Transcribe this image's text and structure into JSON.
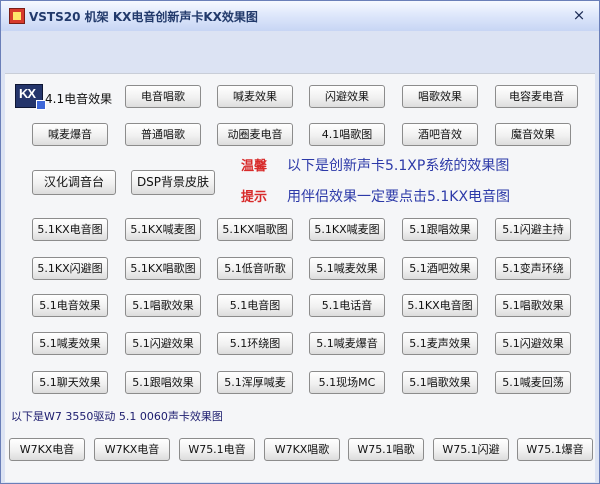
{
  "window": {
    "title": "VSTS20 机架 KX电音创新声卡KX效果图",
    "close_glyph": "×"
  },
  "logo": {
    "text": "KX"
  },
  "label_41": "4.1电音效果",
  "row1": [
    "电音唱歌",
    "喊麦效果",
    "闪避效果",
    "唱歌效果",
    "电容麦电音"
  ],
  "row2": [
    "喊麦爆音",
    "普通唱歌",
    "动圈麦电音",
    "4.1唱歌图",
    "酒吧音效",
    "魔音效果"
  ],
  "tools": [
    "汉化调音台",
    "DSP背景皮肤"
  ],
  "info": [
    {
      "label": "温馨",
      "text": "以下是创新声卡5.1XP系统的效果图"
    },
    {
      "label": "提示",
      "text": "用伴侣效果一定要点击5.1KX电音图"
    }
  ],
  "grid": [
    [
      "5.1KX电音图",
      "5.1KX喊麦图",
      "5.1KX唱歌图",
      "5.1KX喊麦图",
      "5.1跟唱效果",
      "5.1闪避主持"
    ],
    [
      "5.1KX闪避图",
      "5.1KX唱歌图",
      "5.1低音听歌",
      "5.1喊麦效果",
      "5.1酒吧效果",
      "5.1变声环绕"
    ],
    [
      "5.1电音效果",
      "5.1唱歌效果",
      "5.1电音图",
      "5.1电话音",
      "5.1KX电音图",
      "5.1唱歌效果"
    ],
    [
      "5.1喊麦效果",
      "5.1闪避效果",
      "5.1环绕图",
      "5.1喊麦爆音",
      "5.1麦声效果",
      "5.1闪避效果"
    ],
    [
      "5.1聊天效果",
      "5.1跟唱效果",
      "5.1浑厚喊麦",
      "5.1现场MC",
      "5.1唱歌效果",
      "5.1喊麦回荡"
    ]
  ],
  "section_label": "以下是W7 3550驱动 5.1 0060声卡效果图",
  "w7": [
    "W7KX电音",
    "W7KX电音",
    "W75.1电音",
    "W7KX唱歌",
    "W75.1唱歌",
    "W75.1闪避",
    "W75.1爆音"
  ]
}
